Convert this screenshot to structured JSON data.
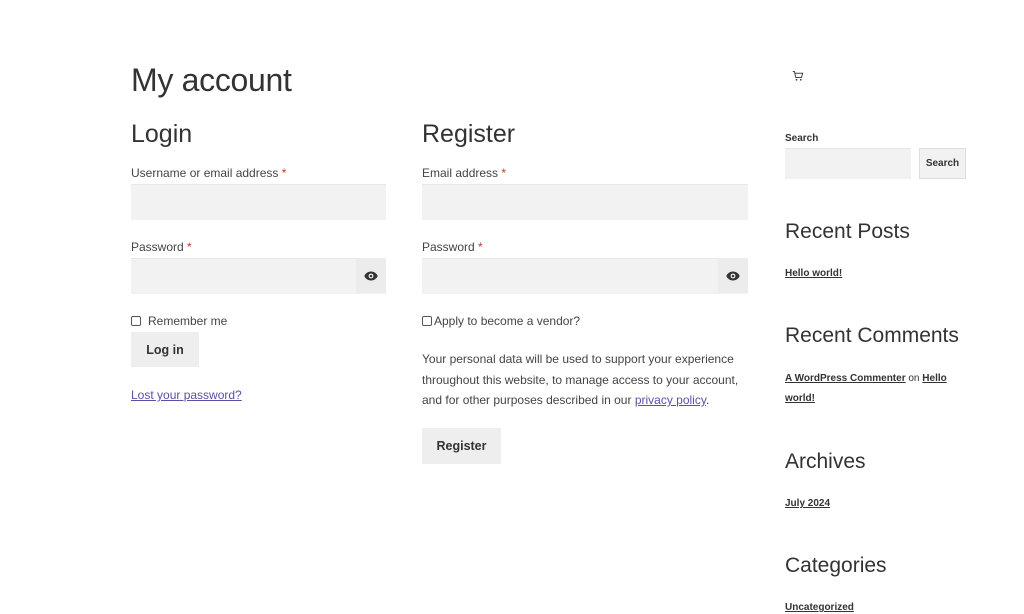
{
  "page": {
    "title": "My account"
  },
  "login": {
    "heading": "Login",
    "username_label": "Username or email address",
    "password_label": "Password",
    "required_mark": "*",
    "remember_label": "Remember me",
    "submit_label": "Log in",
    "lost_password_link": "Lost your password?"
  },
  "register": {
    "heading": "Register",
    "email_label": "Email address",
    "password_label": "Password",
    "required_mark": "*",
    "vendor_label": "Apply to become a vendor?",
    "privacy_text_1": "Your personal data will be used to support your experience",
    "privacy_text_2": "throughout this website, to manage access to your account,",
    "privacy_text_3": "and for other purposes described in our",
    "privacy_link": "privacy policy",
    "privacy_end": ".",
    "submit_label": "Register"
  },
  "sidebar": {
    "cart_icon": "cart-icon",
    "search": {
      "label": "Search",
      "button": "Search",
      "value": ""
    },
    "recent_posts": {
      "title": "Recent Posts",
      "items": [
        "Hello world!"
      ]
    },
    "recent_comments": {
      "title": "Recent Comments",
      "author": "A WordPress Commenter",
      "on": "on",
      "post_part1": "Hello",
      "post_part2": "world!"
    },
    "archives": {
      "title": "Archives",
      "items": [
        "July 2024"
      ]
    },
    "categories": {
      "title": "Categories",
      "items": [
        "Uncategorized"
      ]
    }
  }
}
